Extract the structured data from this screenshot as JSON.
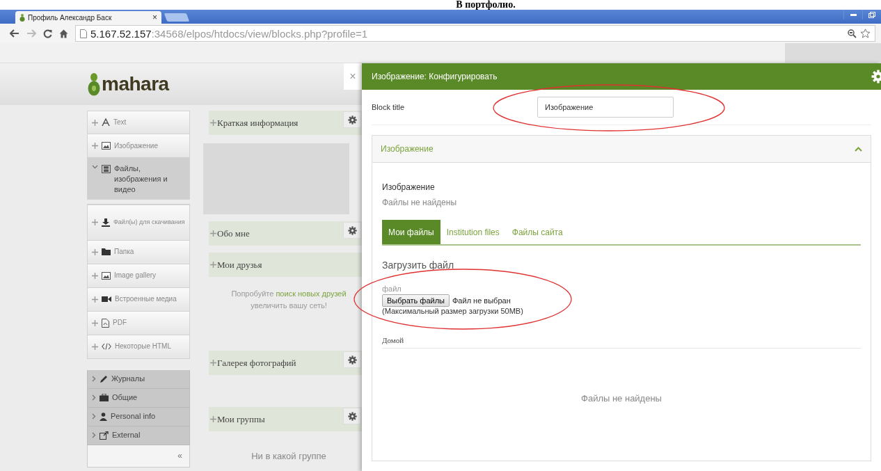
{
  "doc_heading": "В портфолио.",
  "browser": {
    "tab_title": "Профиль Александр Баск",
    "tab_close": "×",
    "url_host": "5.167.52.157",
    "url_path": ":34568/elpos/htdocs/view/blocks.php?profile=1"
  },
  "logo": "mahara",
  "close_button": "×",
  "palette": [
    {
      "kind": "block",
      "label": "Text"
    },
    {
      "kind": "block",
      "label": "Изображение"
    },
    {
      "kind": "category",
      "label": "Файлы, изображения и видео",
      "expanded": true,
      "children": [
        {
          "kind": "block",
          "label": "Файл(ы) для скачивания"
        },
        {
          "kind": "block",
          "label": "Папка"
        },
        {
          "kind": "block",
          "label": "Image gallery"
        },
        {
          "kind": "block",
          "label": "Встроенные медиа"
        },
        {
          "kind": "block",
          "label": "PDF"
        },
        {
          "kind": "block",
          "label": "Некоторые HTML"
        }
      ]
    },
    {
      "kind": "category",
      "label": "Журналы",
      "expanded": false
    },
    {
      "kind": "category",
      "label": "Общие",
      "expanded": false
    },
    {
      "kind": "category",
      "label": "Personal info",
      "expanded": false
    },
    {
      "kind": "category",
      "label": "External",
      "expanded": false
    }
  ],
  "collapse_button": "«",
  "layout_blocks": [
    {
      "kind": "block",
      "title": "Краткая информация",
      "settings": true
    },
    {
      "kind": "blank"
    },
    {
      "kind": "block",
      "title": "Обо мне",
      "settings": true
    },
    {
      "kind": "block",
      "title": "Мои друзья",
      "settings": false
    },
    {
      "kind": "note",
      "before": "Попробуйте ",
      "link": "поиск новых друзей",
      "after": "увеличить вашу сеть!"
    },
    {
      "kind": "block",
      "title": "Галерея фотографий",
      "settings": true
    },
    {
      "kind": "block",
      "title": "Мои группы",
      "settings": true
    },
    {
      "kind": "text",
      "text": "Ни в какой группе"
    }
  ],
  "config_panel": {
    "title": "Изображение: Конфигурировать",
    "block_title_label": "Block title",
    "block_title_value": "Изображение",
    "section": {
      "title": "Изображение",
      "expanded": true,
      "field_label": "Изображение",
      "field_status": "Файлы не найдены",
      "tabs": [
        {
          "label": "Мои файлы",
          "selected": true
        },
        {
          "label": "Institution files",
          "selected": false
        },
        {
          "label": "Файлы сайта",
          "selected": false
        }
      ],
      "upload_heading": "Загрузить файл",
      "file_label": "файл",
      "choose_button": "Выбрать файлы",
      "no_file": "Файл не выбран",
      "max_size": "(Максимальный размер загрузки 50MB)",
      "folder": "Домой",
      "empty": "Файлы не найдены"
    }
  }
}
